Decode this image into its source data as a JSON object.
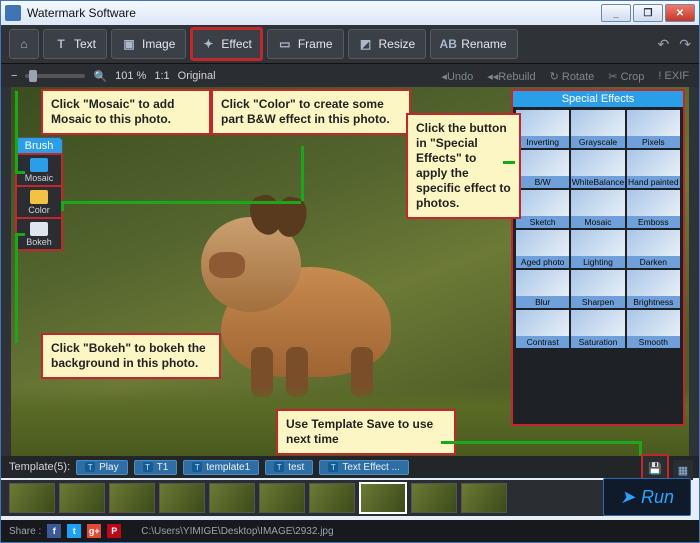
{
  "window": {
    "title": "Watermark Software"
  },
  "window_controls": {
    "min": "_",
    "max": "❐",
    "close": "✕"
  },
  "toolbar": {
    "home": "⌂",
    "text": {
      "icon": "T",
      "label": "Text"
    },
    "image": {
      "icon": "▣",
      "label": "Image"
    },
    "effect": {
      "icon": "✦",
      "label": "Effect"
    },
    "frame": {
      "icon": "▭",
      "label": "Frame"
    },
    "resize": {
      "icon": "◩",
      "label": "Resize"
    },
    "rename": {
      "icon": "AB",
      "label": "Rename"
    },
    "undo_icon": "↶",
    "redo_icon": "↷"
  },
  "subbar": {
    "zoom_out": "−",
    "zoom_in": "🔍",
    "zoom_pct": "101 %",
    "ratio": "1:1",
    "original": "Original",
    "undo": "Undo",
    "rebuild": "Rebuild",
    "rotate": "Rotate",
    "crop": "Crop",
    "exif": "EXIF",
    "exif_icon": "!"
  },
  "brush": {
    "header": "Brush",
    "mosaic": {
      "label": "Mosaic",
      "swatch": "#2a9ee8"
    },
    "color": {
      "label": "Color",
      "swatch": "#f2c244"
    },
    "bokeh": {
      "label": "Bokeh",
      "swatch": "#dfe6ee"
    }
  },
  "fx": {
    "header": "Special Effects",
    "items": [
      "Inverting",
      "Grayscale",
      "Pixels",
      "B/W",
      "WhiteBalance",
      "Hand painted",
      "Sketch",
      "Mosaic",
      "Emboss",
      "Aged photo",
      "Lighting",
      "Darken",
      "Blur",
      "Sharpen",
      "Brightness",
      "Contrast",
      "Saturation",
      "Smooth"
    ]
  },
  "callouts": {
    "mosaic": "Click \"Mosaic\" to add Mosaic to this photo.",
    "color": "Click \"Color\" to create some part B&W effect in this photo.",
    "fx": "Click the button in \"Special Effects\" to apply the specific effect to photos.",
    "bokeh": "Click \"Bokeh\" to bokeh the background in this photo.",
    "tpl": "Use Template Save to use next time"
  },
  "templates": {
    "label": "Template(5):",
    "items": [
      "Play",
      "T1",
      "template1",
      "test",
      "Text Effect ..."
    ],
    "save_icon": "💾",
    "more_icon": "▦"
  },
  "run": {
    "label": "Run",
    "icon": "➤"
  },
  "share": {
    "label": "Share :",
    "path": "C:\\Users\\YIMIGE\\Desktop\\IMAGE\\2932.jpg",
    "f": "f",
    "t": "t",
    "g": "g+",
    "p": "P"
  },
  "colors": {
    "accent": "#2a9ee8",
    "highlight": "#c1272d",
    "leader": "#1aa81a"
  }
}
